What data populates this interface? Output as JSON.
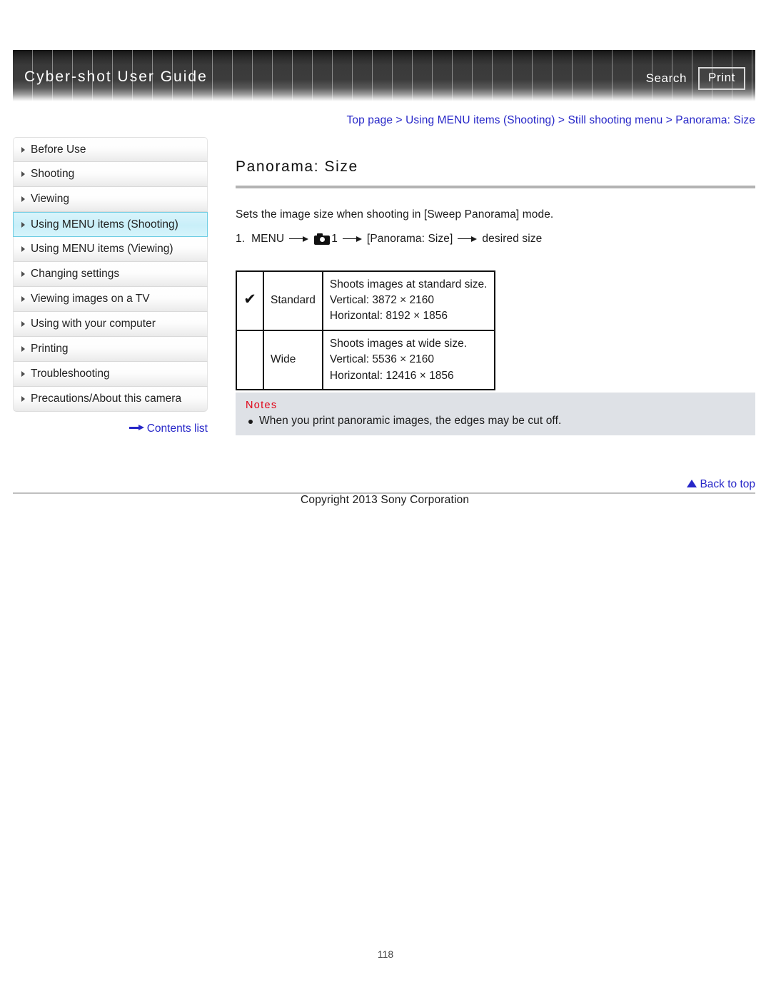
{
  "header": {
    "title": "Cyber-shot User Guide",
    "search_label": "Search",
    "print_label": "Print"
  },
  "breadcrumb": {
    "text": "Top page > Using MENU items (Shooting) > Still shooting menu > Panorama: Size",
    "color": "#2727c8"
  },
  "sidebar": {
    "items": [
      {
        "label": "Before Use",
        "active": false
      },
      {
        "label": "Shooting",
        "active": false
      },
      {
        "label": "Viewing",
        "active": false
      },
      {
        "label": "Using MENU items (Shooting)",
        "active": true
      },
      {
        "label": "Using MENU items (Viewing)",
        "active": false
      },
      {
        "label": "Changing settings",
        "active": false
      },
      {
        "label": "Viewing images on a TV",
        "active": false
      },
      {
        "label": "Using with your computer",
        "active": false
      },
      {
        "label": "Printing",
        "active": false
      },
      {
        "label": "Troubleshooting",
        "active": false
      },
      {
        "label": "Precautions/About this camera",
        "active": false
      }
    ],
    "contents_list_label": "Contents list",
    "active_bg": "#c9eff9",
    "active_border": "#6fcde3"
  },
  "main": {
    "title": "Panorama: Size",
    "intro": "Sets the image size when shooting in [Sweep Panorama] mode.",
    "step": {
      "number": "1.",
      "part1": "MENU",
      "camera_label": "1",
      "part2": "[Panorama: Size]",
      "part3": "desired size"
    },
    "table": {
      "rows": [
        {
          "checked": "✔",
          "label": "Standard",
          "line1": "Shoots images at standard size.",
          "line2": "Vertical: 3872 × 2160",
          "line3": "Horizontal: 8192 × 1856"
        },
        {
          "checked": "",
          "label": "Wide",
          "line1": "Shoots images at wide size.",
          "line2": "Vertical: 5536 × 2160",
          "line3": "Horizontal: 12416 × 1856"
        }
      ]
    },
    "notes": {
      "title": "Notes",
      "title_color": "#e00014",
      "background": "#dee1e6",
      "items": [
        "When you print panoramic images, the edges may be cut off."
      ]
    }
  },
  "footer": {
    "back_to_top_label": "Back to top",
    "copyright": "Copyright 2013 Sony Corporation",
    "page_number": "118"
  }
}
